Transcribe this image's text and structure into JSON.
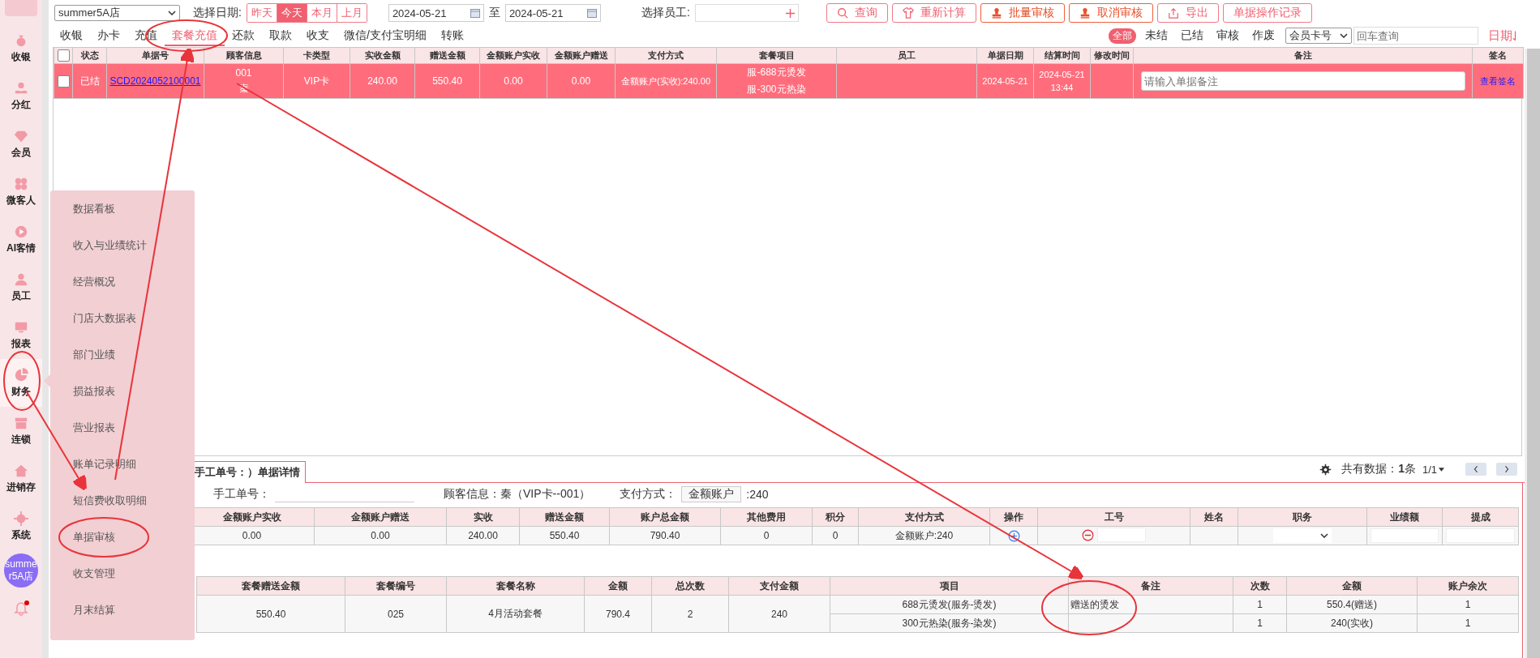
{
  "sidebar": {
    "items": [
      {
        "label": "收银",
        "selected": false
      },
      {
        "label": "分红",
        "selected": false
      },
      {
        "label": "会员",
        "selected": false
      },
      {
        "label": "微客人",
        "selected": false
      },
      {
        "label": "AI客情",
        "selected": false
      },
      {
        "label": "员工",
        "selected": false
      },
      {
        "label": "报表",
        "selected": false
      },
      {
        "label": "财务",
        "selected": true
      },
      {
        "label": "连锁",
        "selected": false
      },
      {
        "label": "进销存",
        "selected": false
      },
      {
        "label": "系统",
        "selected": false
      }
    ],
    "avatar": "summer5A店",
    "notification": {
      "unread": true
    }
  },
  "toolbar": {
    "store_select": "summer5A店",
    "date_label": "选择日期:",
    "date_ranges": [
      {
        "label": "昨天",
        "selected": false
      },
      {
        "label": "今天",
        "selected": true
      },
      {
        "label": "本月",
        "selected": false
      },
      {
        "label": "上月",
        "selected": false
      }
    ],
    "date_from": "2024-05-21",
    "date_separator": "至",
    "date_to": "2024-05-21",
    "staff_label": "选择员工:",
    "buttons": [
      {
        "label": "查询",
        "kind": "normal"
      },
      {
        "label": "重新计算",
        "kind": "normal"
      },
      {
        "label": "批量审核",
        "kind": "accent"
      },
      {
        "label": "取消审核",
        "kind": "accent"
      },
      {
        "label": "导出",
        "kind": "normal"
      },
      {
        "label": "单据操作记录",
        "kind": "normal"
      }
    ]
  },
  "tabs": [
    {
      "label": "收银",
      "selected": false
    },
    {
      "label": "办卡",
      "selected": false
    },
    {
      "label": "充值",
      "selected": false
    },
    {
      "label": "套餐充值",
      "selected": true
    },
    {
      "label": "还款",
      "selected": false
    },
    {
      "label": "取款",
      "selected": false
    },
    {
      "label": "收支",
      "selected": false
    },
    {
      "label": "微信/支付宝明细",
      "selected": false
    },
    {
      "label": "转账",
      "selected": false
    }
  ],
  "status_filters": [
    {
      "label": "全部",
      "selected": true
    },
    {
      "label": "未结",
      "selected": false
    },
    {
      "label": "已结",
      "selected": false
    },
    {
      "label": "审核",
      "selected": false
    },
    {
      "label": "作废",
      "selected": false
    }
  ],
  "search": {
    "field_select": "会员卡号",
    "placeholder": "回车查询"
  },
  "sort": {
    "label": "日期"
  },
  "bill_table": {
    "select_all_checked": false,
    "columns": [
      "状态",
      "单据号",
      "顾客信息",
      "卡类型",
      "实收金额",
      "赠送金额",
      "金额账户实收",
      "金额账户赠送",
      "支付方式",
      "套餐项目",
      "员工",
      "单据日期",
      "结算时间",
      "修改时间",
      "备注",
      "签名"
    ],
    "rows": [
      {
        "selected": true,
        "checked": false,
        "status": "已结",
        "bill_no": "SCD2024052100001",
        "customer": [
          "001",
          "秦"
        ],
        "card_type": "VIP卡",
        "received": "240.00",
        "bonus": "550.40",
        "account_received": "0.00",
        "account_bonus": "0.00",
        "payment": "金额账户(实收):240.00",
        "packages": [
          "服-688元烫发",
          "服-300元热染"
        ],
        "date": "2024-05-21",
        "settle_time": [
          "2024-05-21",
          "13:44"
        ],
        "note_placeholder": "请输入单据备注",
        "signature_link": "查看签名"
      }
    ]
  },
  "popup_menu": {
    "items": [
      "数据看板",
      "收入与业绩统计",
      "经营概况",
      "门店大数据表",
      "部门业绩",
      "损益报表",
      "营业报表",
      "账单记录明细",
      "短信费收取明细",
      "单据审核",
      "收支管理",
      "月末结算"
    ]
  },
  "detail": {
    "tab": "手工单号：）单据详情",
    "total": "共有数据：**1**条",
    "page": "1/1",
    "manual_no_label": "手工单号：",
    "customer_info": "顾客信息：秦（VIP卡--001）",
    "payment_label": "支付方式：",
    "payment_value": "金额账户",
    "payment_amount": ":240",
    "payment_table": {
      "columns": [
        "金额账户实收",
        "金额账户赠送",
        "实收",
        "赠送金额",
        "账户总金额",
        "其他费用",
        "积分",
        "支付方式",
        "操作",
        "工号",
        "姓名",
        "职务",
        "业绩额",
        "提成"
      ],
      "cells": [
        {
          "kind": "text",
          "text": "0.00"
        },
        {
          "kind": "text",
          "text": "0.00"
        },
        {
          "kind": "text",
          "text": "240.00"
        },
        {
          "kind": "text",
          "text": "550.40"
        },
        {
          "kind": "text",
          "text": "790.40"
        },
        {
          "kind": "text",
          "text": "0"
        },
        {
          "kind": "text",
          "text": "0"
        },
        {
          "kind": "text",
          "text": "金额账户:240"
        },
        {
          "kind": "add"
        },
        {
          "kind": "remove-input"
        },
        {
          "kind": "empty"
        },
        {
          "kind": "select"
        },
        {
          "kind": "input"
        },
        {
          "kind": "input"
        }
      ]
    },
    "package_table": {
      "columns": [
        "套餐赠送金额",
        "套餐编号",
        "套餐名称",
        "金额",
        "总次数",
        "支付金额"
      ],
      "values": [
        "550.40",
        "025",
        "4月活动套餐",
        "790.4",
        "2",
        "240"
      ],
      "item_columns": [
        "项目",
        "备注",
        "次数",
        "金额",
        "账户余次"
      ],
      "items": [
        {
          "item": "688元烫发(服务-烫发)",
          "note": "赠送的烫发",
          "times": "1",
          "amount": "550.4(赠送)",
          "remaining": "1"
        },
        {
          "item": "300元热染(服务-染发)",
          "times": "1",
          "amount": "240(实收)",
          "remaining": "1"
        }
      ]
    }
  }
}
